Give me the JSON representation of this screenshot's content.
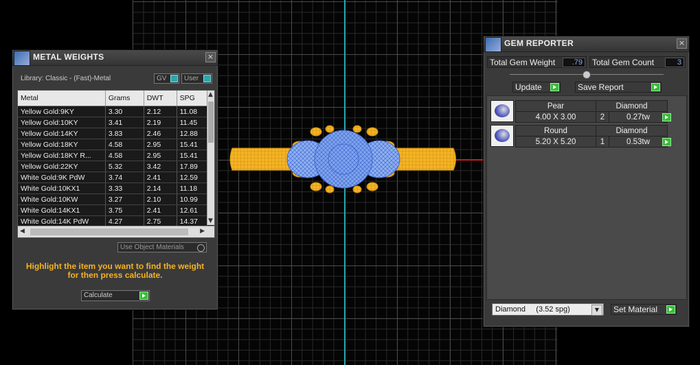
{
  "metal_weights": {
    "title": "METAL WEIGHTS",
    "library": "Library: Classic - (Fast)-Metal",
    "toggle_gv": "GV",
    "toggle_user": "User",
    "columns": [
      "Metal",
      "Grams",
      "DWT",
      "SPG"
    ],
    "rows": [
      [
        "Yellow Gold:9KY",
        "3.30",
        "2.12",
        "11.08"
      ],
      [
        "Yellow Gold:10KY",
        "3.41",
        "2.19",
        "11.45"
      ],
      [
        "Yellow Gold:14KY",
        "3.83",
        "2.46",
        "12.88"
      ],
      [
        "Yellow Gold:18KY",
        "4.58",
        "2.95",
        "15.41"
      ],
      [
        "Yellow Gold:18KY R...",
        "4.58",
        "2.95",
        "15.41"
      ],
      [
        "Yellow Gold:22KY",
        "5.32",
        "3.42",
        "17.89"
      ],
      [
        "White Gold:9K PdW",
        "3.74",
        "2.41",
        "12.59"
      ],
      [
        "White Gold:10KX1",
        "3.33",
        "2.14",
        "11.18"
      ],
      [
        "White Gold:10KW",
        "3.27",
        "2.10",
        "10.99"
      ],
      [
        "White Gold:14KX1",
        "3.75",
        "2.41",
        "12.61"
      ],
      [
        "White Gold:14K PdW",
        "4.27",
        "2.75",
        "14.37"
      ]
    ],
    "use_object_materials": "Use Object Materials",
    "message": "Highlight the item you want to find the weight for then press calculate.",
    "calculate": "Calculate",
    "close": "×"
  },
  "gem_reporter": {
    "title": "GEM REPORTER",
    "total_weight_label": "Total Gem Weight",
    "total_weight_value": ".79",
    "total_count_label": "Total Gem Count",
    "total_count_value": "3",
    "update": "Update",
    "save_report": "Save Report",
    "gems": [
      {
        "shape": "Pear",
        "size": "4.00 X 3.00",
        "material": "Diamond",
        "count": "2",
        "weight": "0.27tw"
      },
      {
        "shape": "Round",
        "size": "5.20 X 5.20",
        "material": "Diamond",
        "count": "1",
        "weight": "0.53tw"
      }
    ],
    "material_select": "Diamond     (3.52 spg)",
    "set_material": "Set Material",
    "close": "×"
  },
  "colors": {
    "axis_y": "#2aa7b0",
    "axis_x": "#c02020",
    "metal_gold": "#f5b323",
    "gem_blue": "#7ea4ee",
    "message_text": "#f5b323"
  }
}
